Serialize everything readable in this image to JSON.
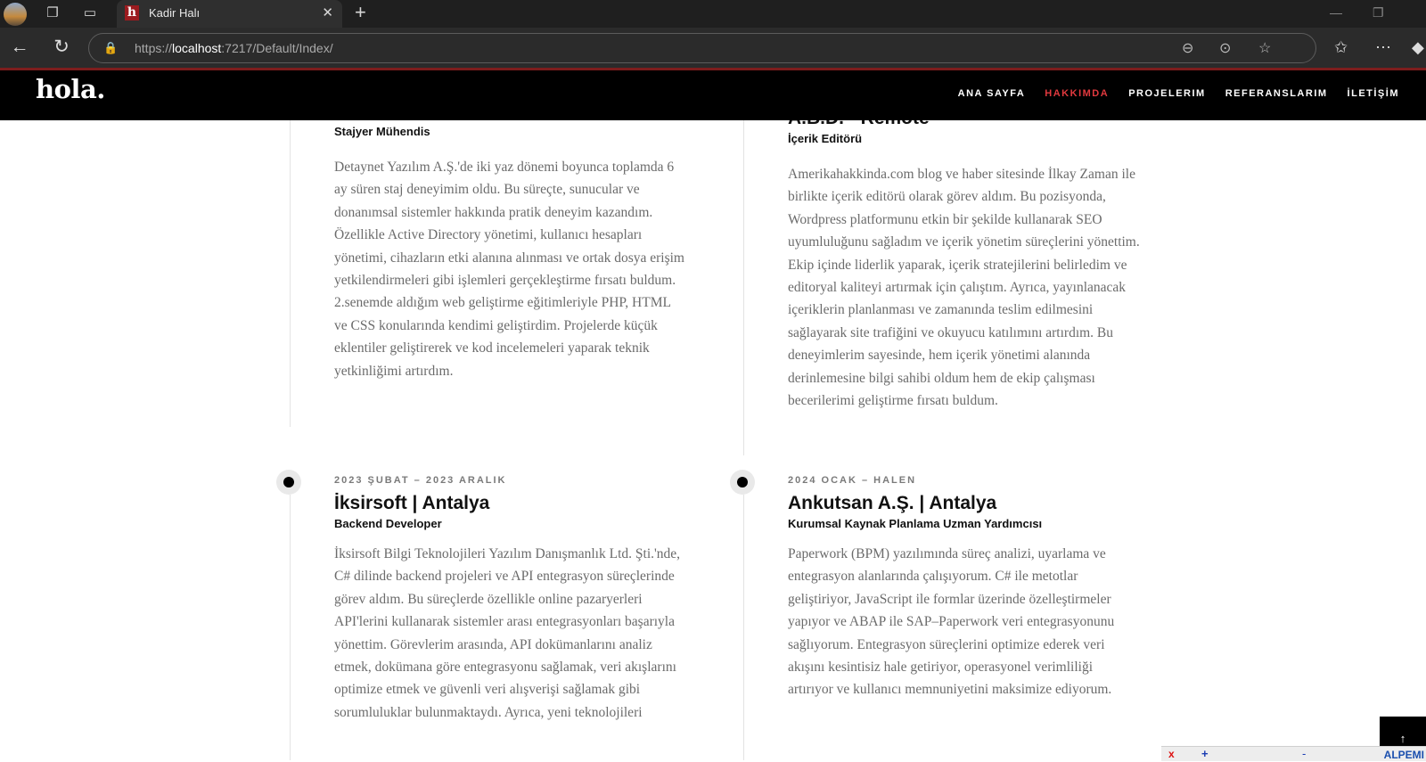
{
  "browser": {
    "tab_title": "Kadir Halı",
    "favicon_letter": "h",
    "url_prefix": "https://",
    "url_host": "localhost",
    "url_rest": ":7217/Default/Index/"
  },
  "site": {
    "logo": "hola.",
    "nav": [
      {
        "label": "ANA SAYFA",
        "active": false
      },
      {
        "label": "HAKKIMDA",
        "active": true
      },
      {
        "label": "PROJELERIM",
        "active": false
      },
      {
        "label": "REFERANSLARIM",
        "active": false
      },
      {
        "label": "İLETİŞİM",
        "active": false
      }
    ],
    "accent_color": "#e0393e"
  },
  "timeline": [
    {
      "company_partial": "",
      "role": "Stajyer Mühendis",
      "description": "Detaynet Yazılım A.Ş.'de iki yaz dönemi boyunca toplamda 6 ay süren staj deneyimim oldu. Bu süreçte, sunucular ve donanımsal sistemler hakkında pratik deneyim kazandım. Özellikle Active Directory yönetimi, kullanıcı hesapları yönetimi, cihazların etki alanına alınması ve ortak dosya erişim yetkilendirmeleri gibi işlemleri gerçekleştirme fırsatı buldum. 2.senemde aldığım web geliştirme eğitimleriyle PHP, HTML ve CSS konularında kendimi geliştirdim. Projelerde küçük eklentiler geliştirerek ve kod incelemeleri yaparak teknik yetkinliğimi artırdım."
    },
    {
      "company_partial": "A.B.D. - Remote",
      "role": "İçerik Editörü",
      "description": "Amerikahakkinda.com blog ve haber sitesinde İlkay Zaman ile birlikte içerik editörü olarak görev aldım. Bu pozisyonda, Wordpress platformunu etkin bir şekilde kullanarak SEO uyumluluğunu sağladım ve içerik yönetim süreçlerini yönettim. Ekip içinde liderlik yaparak, içerik stratejilerini belirledim ve editoryal kaliteyi artırmak için çalıştım. Ayrıca, yayınlanacak içeriklerin planlanması ve zamanında teslim edilmesini sağlayarak site trafiğini ve okuyucu katılımını artırdım. Bu deneyimlerim sayesinde, hem içerik yönetimi alanında derinlemesine bilgi sahibi oldum hem de ekip çalışması becerilerimi geliştirme fırsatı buldum."
    },
    {
      "date": "2023 ŞUBAT – 2023 ARALIK",
      "company": "İksirsoft | Antalya",
      "role": "Backend Developer",
      "description": "İksirsoft Bilgi Teknolojileri Yazılım Danışmanlık Ltd. Şti.'nde, C# dilinde backend projeleri ve API entegrasyon süreçlerinde görev aldım. Bu süreçlerde özellikle online pazaryerleri API'lerini kullanarak sistemler arası entegrasyonları başarıyla yönettim. Görevlerim arasında, API dokümanlarını analiz etmek, dokümana göre entegrasyonu sağlamak, veri akışlarını optimize etmek ve güvenli veri alışverişi sağlamak gibi sorumluluklar bulunmaktaydı. Ayrıca, yeni teknolojileri"
    },
    {
      "date": "2024 OCAK – HALEN",
      "company": "Ankutsan A.Ş. | Antalya",
      "role": "Kurumsal Kaynak Planlama Uzman Yardımcısı",
      "description": "Paperwork (BPM) yazılımında süreç analizi, uyarlama ve entegrasyon alanlarında çalışıyorum. C# ile metotlar geliştiriyor, JavaScript ile formlar üzerinde özelleştirmeler yapıyor ve ABAP ile SAP–Paperwork veri entegrasyonunu sağlıyorum. Entegrasyon süreçlerini optimize ederek veri akışını kesintisiz hale getiriyor, operasyonel verimliliği artırıyor ve kullanıcı memnuniyetini maksimize ediyorum."
    }
  ],
  "overlay": {
    "scroll_top_icon": "↑",
    "brand": "ALPEMI"
  }
}
